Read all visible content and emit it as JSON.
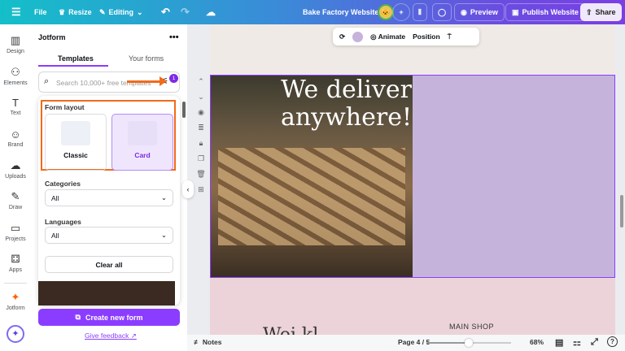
{
  "topbar": {
    "menu_icon": "hamburger-icon",
    "file": "File",
    "resize": "Resize",
    "editing": "Editing",
    "title": "Bake Factory Website",
    "preview": "Preview",
    "publish": "Publish Website",
    "share": "Share"
  },
  "rail": [
    {
      "label": "Design",
      "icon": "▥"
    },
    {
      "label": "Elements",
      "icon": "⚇"
    },
    {
      "label": "Text",
      "icon": "T"
    },
    {
      "label": "Brand",
      "icon": "☺"
    },
    {
      "label": "Uploads",
      "icon": "☁"
    },
    {
      "label": "Draw",
      "icon": "✎"
    },
    {
      "label": "Projects",
      "icon": "▭"
    },
    {
      "label": "Apps",
      "icon": "⚃"
    },
    {
      "label": "Jotform",
      "icon": "✦"
    }
  ],
  "panel": {
    "title": "Jotform",
    "more": "•••",
    "tabs": [
      "Templates",
      "Your forms"
    ],
    "search_placeholder": "Search 10,000+ free templates",
    "filter_badge": "1",
    "filter": {
      "form_layout": "Form layout",
      "layouts": [
        "Classic",
        "Card"
      ],
      "categories_label": "Categories",
      "categories_value": "All",
      "languages_label": "Languages",
      "languages_value": "All",
      "clear": "Clear all"
    },
    "create": "Create new form",
    "feedback": "Give feedback"
  },
  "context_toolbar": {
    "animate": "Animate",
    "position": "Position",
    "color": "#c5b3dc"
  },
  "canvas": {
    "headline": "We deliver anywhere!",
    "lower_text_1": "Wei kl",
    "lower_text_2": "MAIN SHOP"
  },
  "bottom": {
    "notes": "Notes",
    "page": "Page 4 / 5",
    "zoom": "68%",
    "zoom_slider_fraction": 0.5
  }
}
